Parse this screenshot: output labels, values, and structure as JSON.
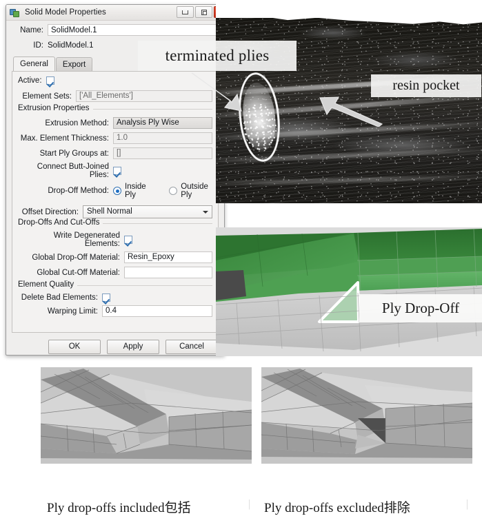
{
  "dialog": {
    "title": "Solid Model Properties",
    "icon": "solid-model-icon",
    "window_buttons": [
      {
        "name": "minimize-button",
        "glyph": "minimize"
      },
      {
        "name": "maximize-button",
        "glyph": "maximize"
      },
      {
        "name": "close-button",
        "glyph": "close",
        "color": "#d8452c"
      }
    ],
    "header": {
      "name_label": "Name:",
      "name_value": "SolidModel.1",
      "id_label": "ID:",
      "id_value": "SolidModel.1"
    },
    "tabs": [
      {
        "label": "General",
        "active": true
      },
      {
        "label": "Export",
        "active": false
      }
    ],
    "general": {
      "active_label": "Active:",
      "active_checked": true,
      "element_sets_label": "Element Sets:",
      "element_sets_value": "['All_Elements']",
      "extrusion_group_title": "Extrusion Properties",
      "extrusion_method_label": "Extrusion Method:",
      "extrusion_method_value": "Analysis Ply Wise",
      "max_element_thickness_label": "Max. Element Thickness:",
      "max_element_thickness_value": "1.0",
      "start_ply_groups_label": "Start Ply Groups at:",
      "start_ply_groups_value": "[]",
      "connect_butt_joined_label": "Connect Butt-Joined Plies:",
      "connect_butt_joined_checked": true,
      "drop_off_method_label": "Drop-Off Method:",
      "drop_off_options": [
        {
          "label": "Inside Ply",
          "selected": true
        },
        {
          "label": "Outside Ply",
          "selected": false
        }
      ],
      "offset_direction_label": "Offset Direction:",
      "offset_direction_value": "Shell Normal",
      "dropoffs_group_title": "Drop-Offs And Cut-Offs",
      "write_degenerated_label": "Write Degenerated Elements:",
      "write_degenerated_checked": true,
      "global_drop_off_material_label": "Global Drop-Off Material:",
      "global_drop_off_material_value": "Resin_Epoxy",
      "global_cut_off_material_label": "Global Cut-Off Material:",
      "global_cut_off_material_value": "",
      "element_quality_group_title": "Element Quality",
      "delete_bad_elements_label": "Delete Bad Elements:",
      "delete_bad_elements_checked": true,
      "warping_limit_label": "Warping Limit:",
      "warping_limit_value": "0.4"
    },
    "buttons": [
      {
        "label": "OK",
        "name": "ok-button"
      },
      {
        "label": "Apply",
        "name": "apply-button"
      },
      {
        "label": "Cancel",
        "name": "cancel-button"
      }
    ]
  },
  "annotations": {
    "terminated_plies": "terminated plies",
    "resin_pocket": "resin pocket",
    "ply_drop_off": "Ply Drop-Off"
  },
  "figures": {
    "micrograph_name": "composite-micrograph",
    "green_render_name": "ply-drop-off-3d-render",
    "left_render_name": "mesh-with-ply-drop-offs",
    "right_render_name": "mesh-without-ply-drop-offs",
    "caption_left": "Ply drop-offs included包括",
    "caption_right": "Ply drop-offs excluded排除"
  },
  "colors": {
    "accent_green_dark": "#2f7d32",
    "accent_green_mid": "#4aa055",
    "accent_green_light": "#93c79a",
    "mesh_grey_light": "#c9c9c9",
    "mesh_grey_mid": "#a9a9a9",
    "mesh_grey_dark": "#808080",
    "dialog_bg": "#efeeed",
    "close_red": "#d8452c",
    "radio_blue": "#1f6fc4"
  }
}
